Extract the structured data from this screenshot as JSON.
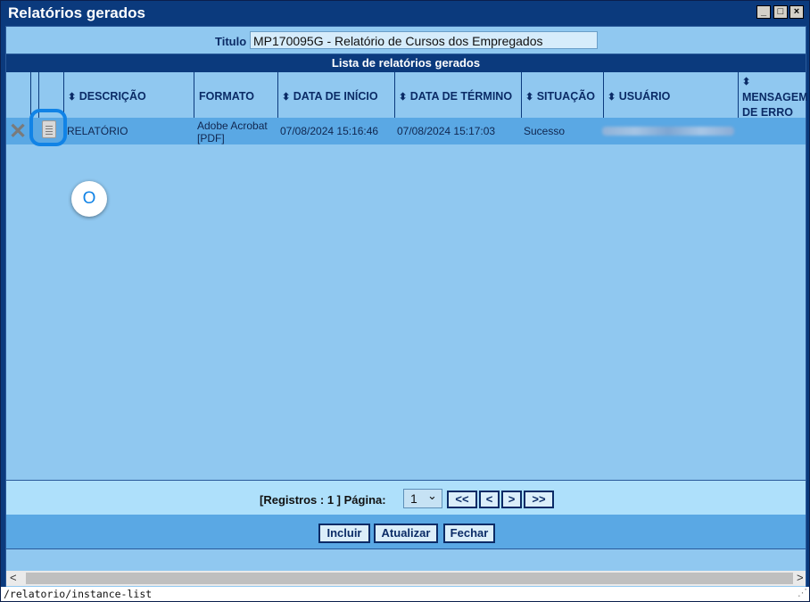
{
  "window": {
    "title": "Relatórios gerados",
    "controls": [
      "minimize",
      "maximize",
      "close"
    ]
  },
  "titulo": {
    "label": "Titulo",
    "value": "MP170095G - Relatório de Cursos dos Empregados"
  },
  "list": {
    "header": "Lista de relatórios gerados",
    "sort_glyph": "⬍",
    "columns": [
      "DESCRIÇÃO",
      "FORMATO",
      "DATA DE INÍCIO",
      "DATA DE TÉRMINO",
      "SITUAÇÃO",
      "USUÁRIO",
      "MENSAGEM",
      "DE ERRO"
    ],
    "rows": [
      {
        "descricao": "RELATÓRIO",
        "formato_line1": "Adobe Acrobat",
        "formato_line2": "[PDF]",
        "data_inicio": "07/08/2024 15:16:46",
        "data_termino": "07/08/2024 15:17:03",
        "situacao": "Sucesso",
        "usuario": "",
        "mensagem": ""
      }
    ]
  },
  "annotation_badge": "O",
  "pager": {
    "info": "[Registros : 1 ] Página:",
    "page_selected": "1",
    "page_caret": "⌄",
    "first": "<<",
    "prev": "<",
    "next": ">",
    "last": ">>"
  },
  "actions": {
    "incluir": "Incluir",
    "atualizar": "Atualizar",
    "fechar": "Fechar"
  },
  "scroll": {
    "left": "<",
    "right": ">"
  },
  "status_url": "/relatorio/instance-list",
  "colors": {
    "titlebar": "#0b3a7d",
    "panel": "#90c8f0",
    "selected_row": "#5aa8e4",
    "focus_ring": "#1183e6"
  },
  "icons": [
    "delete-icon",
    "document-icon",
    "sort-icon",
    "resize-grip-icon"
  ]
}
